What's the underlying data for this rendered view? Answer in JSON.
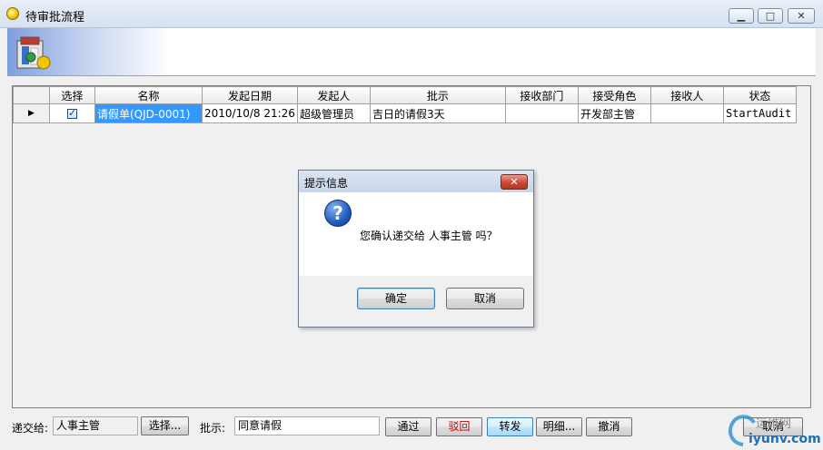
{
  "window": {
    "title": "待审批流程",
    "minimize": "▁",
    "maximize": "□",
    "close": "✕"
  },
  "grid": {
    "columns": [
      "选择",
      "名称",
      "发起日期",
      "发起人",
      "批示",
      "接收部门",
      "接受角色",
      "接收人",
      "状态"
    ],
    "rows": [
      {
        "indicator": "▶",
        "checked": true,
        "name": "请假单(QJD-0001)",
        "date": "2010/10/8 21:26",
        "initiator": "超级管理员",
        "comment": "吉日的请假3天",
        "dept": "",
        "role": "开发部主管",
        "receiver": "",
        "status": "StartAudit"
      }
    ]
  },
  "dialog": {
    "title": "提示信息",
    "close": "✕",
    "icon": "question-icon",
    "icon_glyph": "?",
    "message": "您确认递交给 人事主管 吗？",
    "ok": "确定",
    "cancel": "取消"
  },
  "bottom": {
    "send_to_label": "递交给:",
    "send_to_value": "人事主管",
    "choose": "选择...",
    "comment_label": "批示:",
    "comment_value": "同意请假",
    "pass": "通过",
    "reject": "驳回",
    "forward": "转发",
    "detail": "明细...",
    "revoke": "撤消",
    "cancel": "取消"
  },
  "watermark": {
    "brand": "运维网",
    "url": "iyunv.com"
  },
  "colors": {
    "selected_cell": "#3399ff",
    "reject_text": "#c00000"
  }
}
